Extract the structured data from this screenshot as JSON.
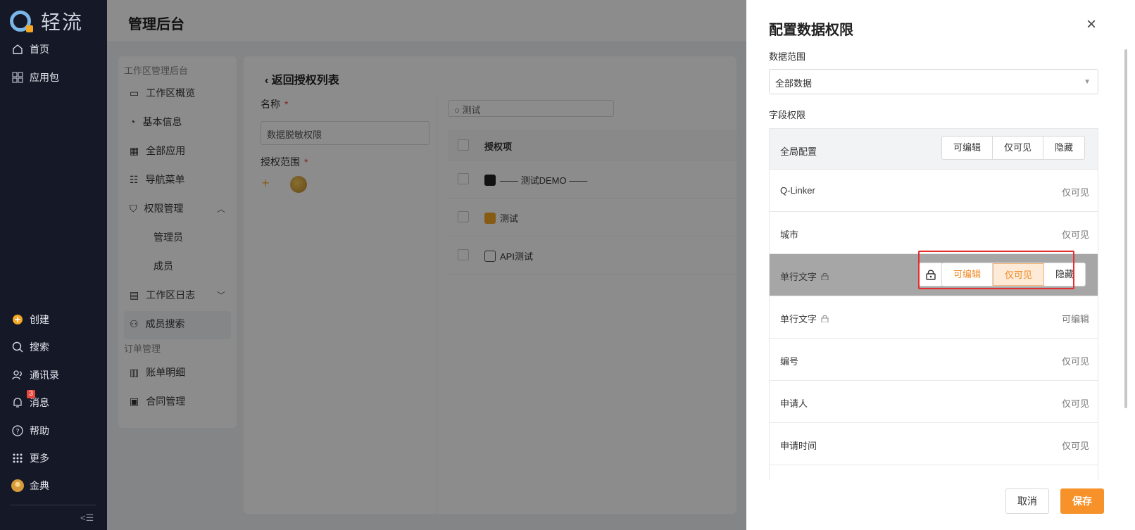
{
  "brand": {
    "name": "轻流"
  },
  "leftnav": {
    "top_items": [
      {
        "label": "首页",
        "icon": "home-icon"
      },
      {
        "label": "应用包",
        "icon": "grid-icon"
      }
    ],
    "bottom_items": [
      {
        "label": "创建",
        "icon": "plus-circle-icon"
      },
      {
        "label": "搜索",
        "icon": "search-icon"
      },
      {
        "label": "通讯录",
        "icon": "contacts-icon"
      },
      {
        "label": "消息",
        "icon": "bell-icon",
        "badge": "3"
      },
      {
        "label": "帮助",
        "icon": "help-icon"
      },
      {
        "label": "更多",
        "icon": "more-grid-icon"
      },
      {
        "label": "金典",
        "icon": "avatar"
      }
    ],
    "collapse_icon": "collapse-icon"
  },
  "topbar": {
    "title": "管理后台"
  },
  "submenu": {
    "group1": "工作区管理后台",
    "items": [
      {
        "label": "工作区概览",
        "icon": "monitor-icon"
      },
      {
        "label": "基本信息",
        "icon": "gauge-icon"
      },
      {
        "label": "全部应用",
        "icon": "grid-icon"
      },
      {
        "label": "导航菜单",
        "icon": "sliders-icon"
      },
      {
        "label": "权限管理",
        "icon": "shield-icon"
      },
      {
        "label": "管理员"
      },
      {
        "label": "成员"
      },
      {
        "label": "工作区日志",
        "icon": "calendar-icon"
      },
      {
        "label": "成员搜索",
        "icon": "users-icon"
      }
    ],
    "group2": "订单管理",
    "items2": [
      {
        "label": "账单明细",
        "icon": "bill-icon"
      },
      {
        "label": "合同管理",
        "icon": "contract-icon"
      }
    ]
  },
  "content": {
    "back_label": "返回授权列表",
    "name_label": "名称",
    "required": "*",
    "name_value": "数据脱敏权限",
    "scope_label": "授权范围",
    "search_value": "测试",
    "header": "授权项",
    "rows": [
      {
        "label": "—— 测试DEMO ——",
        "icon_color": "#222222"
      },
      {
        "label": "测试",
        "icon_color": "#f5a623"
      },
      {
        "label": "API测试",
        "icon_color": "#ffffff"
      }
    ]
  },
  "drawer": {
    "title": "配置数据权限",
    "data_scope_label": "数据范围",
    "data_scope_value": "全部数据",
    "field_perm_label": "字段权限",
    "global_label": "全局配置",
    "options": [
      "可编辑",
      "仅可见",
      "隐藏"
    ],
    "fields": [
      {
        "name": "Q-Linker",
        "value": "仅可见"
      },
      {
        "name": "城市",
        "value": "仅可见"
      },
      {
        "name": "单行文字",
        "value": "",
        "locked": true
      },
      {
        "name": "单行文字",
        "value": "可编辑",
        "locked": true
      },
      {
        "name": "编号",
        "value": "仅可见"
      },
      {
        "name": "申请人",
        "value": "仅可见"
      },
      {
        "name": "申请时间",
        "value": "仅可见"
      }
    ],
    "cancel": "取消",
    "save": "保存"
  },
  "colors": {
    "accent": "#f7922b",
    "highlight": "#e62e2e",
    "nav_bg": "#151826"
  }
}
